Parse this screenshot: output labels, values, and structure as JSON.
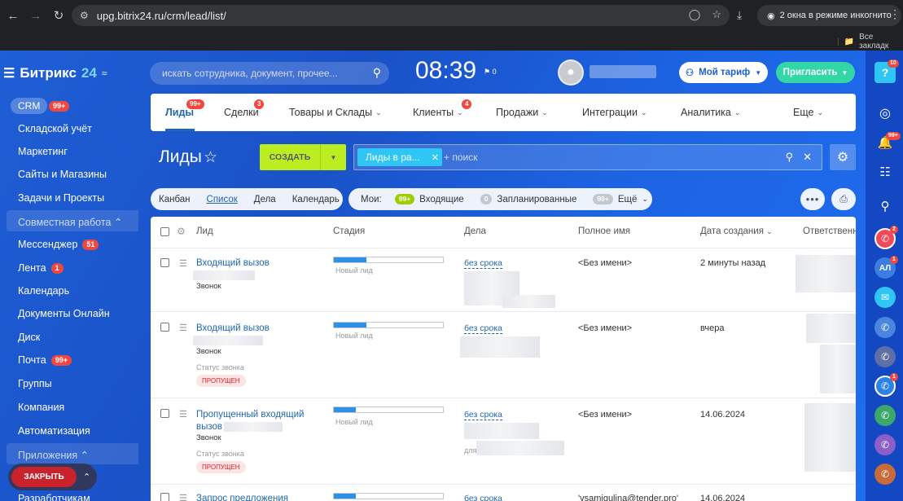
{
  "browser": {
    "url": "upg.bitrix24.ru/crm/lead/list/",
    "incognito_label": "2 окна в режиме инкогнито",
    "bookmarks_label": "Все закладк"
  },
  "logo": {
    "name": "Битрикс",
    "num": "24"
  },
  "sidebar": {
    "crm": {
      "label": "CRM",
      "badge": "99+"
    },
    "items": [
      {
        "label": "Складской учёт"
      },
      {
        "label": "Маркетинг"
      },
      {
        "label": "Сайты и Магазины"
      },
      {
        "label": "Задачи и Проекты"
      }
    ],
    "group1": "Совместная работа",
    "collab": [
      {
        "label": "Мессенджер",
        "badge": "51"
      },
      {
        "label": "Лента",
        "badge": "1"
      },
      {
        "label": "Календарь"
      },
      {
        "label": "Документы Онлайн"
      },
      {
        "label": "Диск"
      },
      {
        "label": "Почта",
        "badge": "99+"
      },
      {
        "label": "Группы"
      },
      {
        "label": "Компания"
      },
      {
        "label": "Автоматизация"
      }
    ],
    "group2": "Приложения",
    "last": "Разработчикам",
    "close_label": "ЗАКРЫТЬ"
  },
  "header": {
    "search_placeholder": "искать сотрудника, документ, прочее...",
    "time": "08:39",
    "flag_count": "0",
    "tariff": "Мой тариф",
    "invite": "Пригласить"
  },
  "tabs": [
    {
      "label": "Лиды",
      "badge": "99+",
      "active": true
    },
    {
      "label": "Сделки",
      "badge": "3"
    },
    {
      "label": "Товары и Склады"
    },
    {
      "label": "Клиенты",
      "badge": "4"
    },
    {
      "label": "Продажи"
    },
    {
      "label": "Интеграции"
    },
    {
      "label": "Аналитика"
    },
    {
      "label": "Еще"
    }
  ],
  "toolbar": {
    "title": "Лиды",
    "create": "СОЗДАТЬ",
    "filter_chip": "Лиды в ра...",
    "filter_plus": "+ поиск"
  },
  "views": {
    "items": [
      "Канбан",
      "Список",
      "Дела",
      "Календарь"
    ],
    "mine": "Мои:",
    "incoming_count": "99+",
    "incoming": "Входящие",
    "planned_count": "0",
    "planned": "Запланированные",
    "more_count": "99+",
    "more": "Ещё"
  },
  "grid": {
    "columns": [
      "Лид",
      "Стадия",
      "Дела",
      "Полное имя",
      "Дата создания",
      "Ответственн"
    ],
    "rows": [
      {
        "title": "Входящий вызов",
        "source": "Звонок",
        "stage": "Новый лид",
        "stage_fill": 0.3,
        "deal": "без срока",
        "name": "<Без имени>",
        "created": "2 минуты назад"
      },
      {
        "title": "Входящий вызов",
        "source": "Звонок",
        "call_status_label": "Статус звонка",
        "call_status": "ПРОПУЩЕН",
        "stage": "Новый лид",
        "stage_fill": 0.3,
        "deal": "без срока",
        "name": "<Без имени>",
        "created": "вчера"
      },
      {
        "title": "Пропущенный входящий",
        "title2": "вызов",
        "source": "Звонок",
        "call_status_label": "Статус звонка",
        "call_status": "ПРОПУЩЕН",
        "stage": "Новый лид",
        "stage_fill": 0.2,
        "deal": "без срока",
        "deal_note": "для",
        "name": "<Без имени>",
        "created": "14.06.2024"
      },
      {
        "title": "Запрос предложения",
        "stage_fill": 0.2,
        "deal": "без срока",
        "name": "'vsamigulina@tender.pro'",
        "created": "14.06.2024"
      }
    ]
  },
  "rightbar": {
    "help_badge": "10",
    "notif_badge": "99+",
    "phone_badge": "2",
    "user_initials": "АЛ",
    "user_badge": "1",
    "call_badge": "1"
  }
}
